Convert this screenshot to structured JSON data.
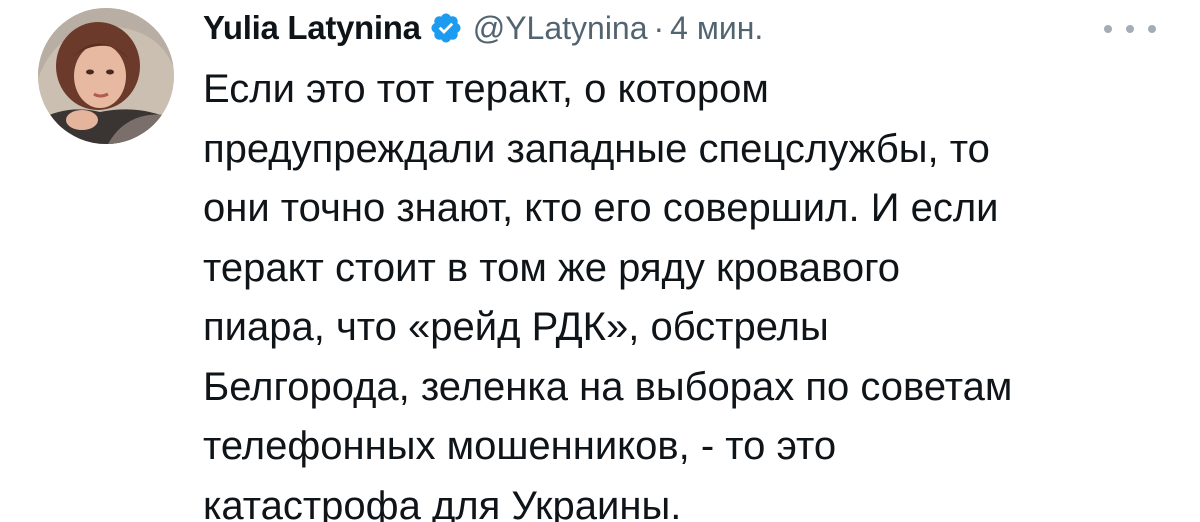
{
  "tweet": {
    "display_name": "Yulia Latynina",
    "handle": "@YLatynina",
    "separator": "·",
    "timestamp": "4 мин.",
    "verified_icon": "verified-badge-icon",
    "more_icon": "more-options-icon",
    "avatar": "profile-avatar-photo",
    "text_lines": [
      "Если это тот теракт, о котором",
      "предупреждали западные спецслужбы, то",
      "они точно знают, кто его совершил. И если",
      "теракт стоит в том же ряду кровавого",
      "пиара, что «рейд РДК», обстрелы",
      "Белгорода, зеленка на выборах по советам",
      "телефонных мошенников, - то это",
      "катастрофа для Украины."
    ]
  },
  "colors": {
    "text_primary": "#0f1419",
    "text_secondary": "#536471",
    "verified": "#1d9bf0"
  }
}
